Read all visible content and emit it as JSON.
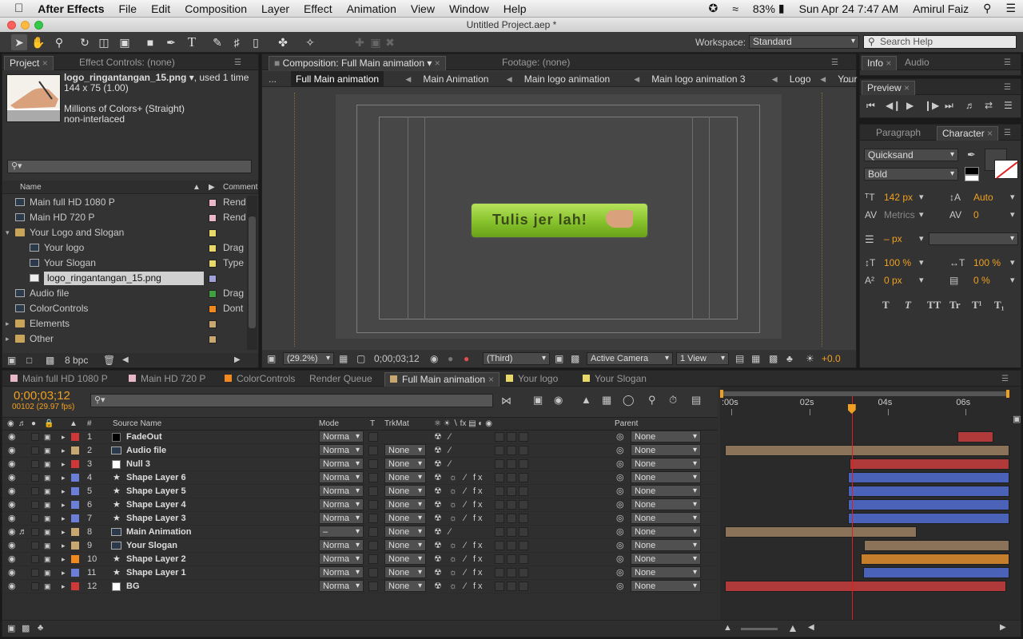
{
  "macmenu": {
    "apple": "",
    "app": "After Effects",
    "items": [
      "File",
      "Edit",
      "Composition",
      "Layer",
      "Effect",
      "Animation",
      "View",
      "Window",
      "Help"
    ],
    "battery": "83%",
    "datetime": "Sun Apr 24  7:47 AM",
    "user": "Amirul Faiz"
  },
  "window": {
    "title": "Untitled Project.aep *"
  },
  "toolbar": {
    "workspace_label": "Workspace:",
    "workspace_value": "Standard",
    "search_placeholder": "Search Help"
  },
  "project": {
    "tab": "Project",
    "tab2": "Effect Controls: (none)",
    "asset_name": "logo_ringantangan_15.png",
    "asset_used": ", used 1 time",
    "asset_size": "144 x 75 (1.00)",
    "asset_colors": "Millions of Colors+ (Straight)",
    "asset_interlace": "non-interlaced",
    "col_name": "Name",
    "col_comment": "Comment",
    "bpc": "8 bpc",
    "items": [
      {
        "name": "Main full HD 1080 P",
        "comment": "Rend",
        "color": "#e8b8c8",
        "indent": 0,
        "type": "comp"
      },
      {
        "name": "Main HD 720 P",
        "comment": "Rend",
        "color": "#e8b8c8",
        "indent": 0,
        "type": "comp"
      },
      {
        "name": "Your Logo and Slogan",
        "comment": "",
        "color": "#e8d86a",
        "indent": 0,
        "type": "folder"
      },
      {
        "name": "Your logo",
        "comment": "Drag",
        "color": "#e8d86a",
        "indent": 1,
        "type": "comp"
      },
      {
        "name": "Your Slogan",
        "comment": "Type",
        "color": "#e8d86a",
        "indent": 1,
        "type": "comp"
      },
      {
        "name": "logo_ringantangan_15.png",
        "comment": "",
        "color": "#a0a0d8",
        "indent": 1,
        "type": "file"
      },
      {
        "name": "Audio file",
        "comment": "Drag",
        "color": "#40a040",
        "indent": 0,
        "type": "comp"
      },
      {
        "name": "ColorControls",
        "comment": "Dont",
        "color": "#f08a20",
        "indent": 0,
        "type": "comp"
      },
      {
        "name": "Elements",
        "comment": "",
        "color": "#c8a870",
        "indent": 0,
        "type": "folder"
      },
      {
        "name": "Other",
        "comment": "",
        "color": "#c8a870",
        "indent": 0,
        "type": "folder"
      }
    ]
  },
  "composition": {
    "tab": "Composition: Full Main animation",
    "footage_tab": "Footage: (none)",
    "breadcrumbs": [
      "Full Main animation",
      "Main Animation",
      "Main logo animation",
      "Main logo animation 3",
      "Logo",
      "Your logo"
    ],
    "breadcrumb_more": "...",
    "logo_text": "Tulis jer lah!",
    "zoom": "(29.2%)",
    "timecode": "0;00;03;12",
    "resolution": "(Third)",
    "camera": "Active Camera",
    "views": "1 View",
    "exposure": "+0.0"
  },
  "info_panel": {
    "tab1": "Info",
    "tab2": "Audio"
  },
  "preview_panel": {
    "tab": "Preview"
  },
  "character_panel": {
    "tab1": "Paragraph",
    "tab2": "Character",
    "font": "Quicksand",
    "style": "Bold",
    "size": "142 px",
    "leading": "Auto",
    "kerning": "Metrics",
    "tracking": "0",
    "stroke": "– px",
    "vscale": "100 %",
    "hscale": "100 %",
    "baseline": "0 px",
    "tsume": "0 %",
    "styles": [
      "T",
      "T",
      "TT",
      "Tr",
      "T¹",
      "T₁"
    ]
  },
  "timeline": {
    "tabs": [
      {
        "label": "Main full HD 1080 P",
        "color": "#e8b8c8"
      },
      {
        "label": "Main HD 720 P",
        "color": "#e8b8c8"
      },
      {
        "label": "ColorControls",
        "color": "#f08a20"
      },
      {
        "label": "Render Queue",
        "color": ""
      },
      {
        "label": "Full Main animation",
        "color": "#c8a870"
      },
      {
        "label": "Your logo",
        "color": "#e8d86a"
      },
      {
        "label": "Your Slogan",
        "color": "#e8d86a"
      }
    ],
    "timecode": "0;00;03;12",
    "frame": "00102 (29.97 fps)",
    "headers": {
      "num": "#",
      "source": "Source Name",
      "mode": "Mode",
      "t": "T",
      "trkmat": "TrkMat",
      "parent": "Parent"
    },
    "ruler": [
      ":00s",
      "02s",
      "04s",
      "06s"
    ],
    "layers": [
      {
        "num": "1",
        "name": "FadeOut",
        "color": "#d03838",
        "icon": "black",
        "mode": "Norma",
        "trkmat": "",
        "parent": "None",
        "bar_start": 0.805,
        "bar_end": 0.945,
        "bar_color": "#b03a3a"
      },
      {
        "num": "2",
        "name": "Audio file",
        "color": "#c8a870",
        "icon": "comp",
        "mode": "Norma",
        "trkmat": "None",
        "parent": "None",
        "bar_start": 0.0,
        "bar_end": 1.0,
        "bar_color": "#8a7358"
      },
      {
        "num": "3",
        "name": "Null 3",
        "color": "#d03838",
        "icon": "white",
        "mode": "Norma",
        "trkmat": "None",
        "parent": "None",
        "bar_start": 0.43,
        "bar_end": 1.0,
        "bar_color": "#b03a3a"
      },
      {
        "num": "4",
        "name": "Shape Layer 6",
        "color": "#6b7fd8",
        "icon": "star",
        "mode": "Norma",
        "trkmat": "None",
        "parent": "None",
        "bar_start": 0.425,
        "bar_end": 1.0,
        "bar_color": "#4a62b8"
      },
      {
        "num": "5",
        "name": "Shape Layer 5",
        "color": "#6b7fd8",
        "icon": "star",
        "mode": "Norma",
        "trkmat": "None",
        "parent": "None",
        "bar_start": 0.425,
        "bar_end": 1.0,
        "bar_color": "#4a62b8"
      },
      {
        "num": "6",
        "name": "Shape Layer 4",
        "color": "#6b7fd8",
        "icon": "star",
        "mode": "Norma",
        "trkmat": "None",
        "parent": "None",
        "bar_start": 0.425,
        "bar_end": 1.0,
        "bar_color": "#4a62b8"
      },
      {
        "num": "7",
        "name": "Shape Layer 3",
        "color": "#6b7fd8",
        "icon": "star",
        "mode": "Norma",
        "trkmat": "None",
        "parent": "None",
        "bar_start": 0.425,
        "bar_end": 1.0,
        "bar_color": "#4a62b8"
      },
      {
        "num": "8",
        "name": "Main Animation",
        "color": "#c8a870",
        "icon": "comp",
        "mode": "–",
        "trkmat": "None",
        "parent": "None",
        "bar_start": 0.0,
        "bar_end": 0.68,
        "bar_color": "#8a7358"
      },
      {
        "num": "9",
        "name": " Your Slogan",
        "color": "#c8a870",
        "icon": "comp",
        "mode": "Norma",
        "trkmat": "None",
        "parent": "None",
        "bar_start": 0.48,
        "bar_end": 1.0,
        "bar_color": "#8a7358"
      },
      {
        "num": "10",
        "name": "Shape Layer 2",
        "color": "#f08a20",
        "icon": "star",
        "mode": "Norma",
        "trkmat": "None",
        "parent": "None",
        "bar_start": 0.47,
        "bar_end": 1.0,
        "bar_color": "#c47e2c"
      },
      {
        "num": "11",
        "name": "Shape Layer 1",
        "color": "#6b7fd8",
        "icon": "star",
        "mode": "Norma",
        "trkmat": "None",
        "parent": "None",
        "bar_start": 0.478,
        "bar_end": 1.0,
        "bar_color": "#4a62b8"
      },
      {
        "num": "12",
        "name": "BG",
        "color": "#d03838",
        "icon": "white",
        "mode": "Norma",
        "trkmat": "None",
        "parent": "None",
        "bar_start": 0.0,
        "bar_end": 0.99,
        "bar_color": "#b03a3a"
      }
    ],
    "playhead": 0.455
  },
  "colors": {
    "accent": "#f0a020",
    "panel": "#333333",
    "bg": "#262626"
  }
}
